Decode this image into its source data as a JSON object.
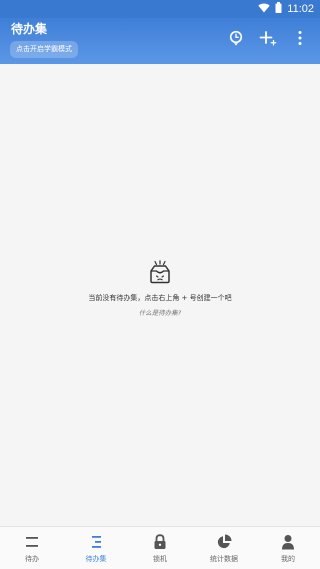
{
  "status_bar": {
    "time": "11:02"
  },
  "app_bar": {
    "title": "待办集",
    "study_mode_button": "点击开启学霸模式",
    "actions": [
      "clock-icon",
      "add-icon",
      "more-vert-icon"
    ]
  },
  "empty_state": {
    "icon": "inbox-sad-face-icon",
    "message": "当前没有待办集，点击右上角 + 号创建一个吧",
    "help_link": "什么是待办集?"
  },
  "bottom_nav": {
    "active_index": 1,
    "items": [
      {
        "label": "待办",
        "icon": "todo-list-icon"
      },
      {
        "label": "待办集",
        "icon": "todo-collection-icon"
      },
      {
        "label": "锁机",
        "icon": "lock-icon"
      },
      {
        "label": "统计数据",
        "icon": "pie-chart-icon"
      },
      {
        "label": "我的",
        "icon": "person-icon"
      }
    ]
  },
  "colors": {
    "primary": "#3f7fd8",
    "status_bar": "#3a79d0",
    "nav_inactive": "#666666",
    "background": "#f5f5f5"
  }
}
